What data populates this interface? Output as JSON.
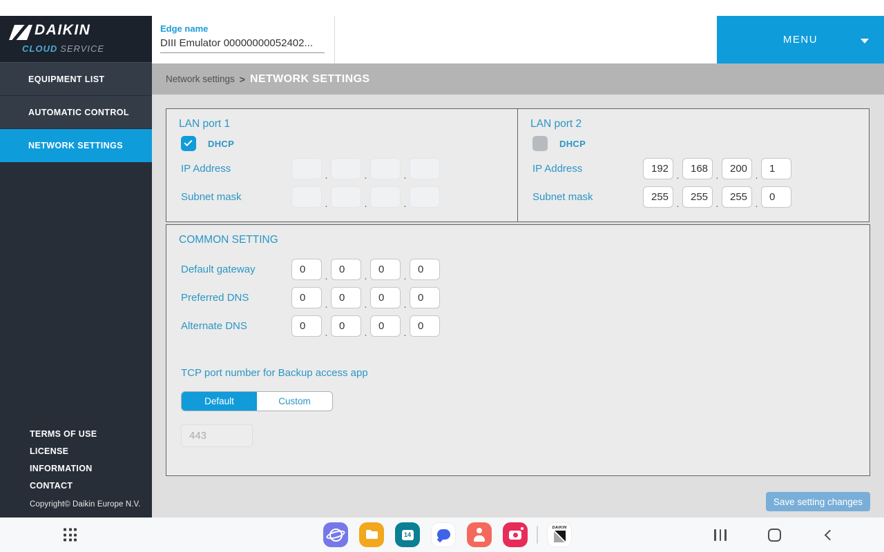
{
  "ui": {
    "dot": "."
  },
  "colors": {
    "accent_blue": "#0f9cdb",
    "label_blue": "#2b96c5",
    "checkbox_blue": "#119bd9",
    "save_button_blue": "#79aed8",
    "breadcrumb_gray": "#b4b4b4",
    "sidebar_dark": "#272e38"
  },
  "sidebar": {
    "logo": {
      "brand": "DAIKIN",
      "cloud": "CLOUD",
      "service": "SERVICE"
    },
    "items": [
      {
        "label": "EQUIPMENT LIST",
        "active": false
      },
      {
        "label": "AUTOMATIC CONTROL",
        "active": false
      },
      {
        "label": "NETWORK SETTINGS",
        "active": true
      }
    ],
    "footer_links": [
      {
        "label": "TERMS OF USE"
      },
      {
        "label": "LICENSE"
      },
      {
        "label": "INFORMATION"
      },
      {
        "label": "CONTACT"
      }
    ],
    "copyright": "Copyright© Daikin Europe N.V."
  },
  "header": {
    "edge_name_label": "Edge name",
    "edge_name_value": "DIII Emulator 00000000052402...",
    "menu_label": "MENU"
  },
  "breadcrumb": {
    "parent": "Network settings",
    "separator": ">",
    "current": "NETWORK SETTINGS"
  },
  "lan_port_1": {
    "title": "LAN port 1",
    "dhcp_label": "DHCP",
    "dhcp_checked": true,
    "ip_label": "IP Address",
    "ip": [
      "",
      "",
      "",
      ""
    ],
    "subnet_label": "Subnet mask",
    "subnet": [
      "",
      "",
      "",
      ""
    ]
  },
  "lan_port_2": {
    "title": "LAN port 2",
    "dhcp_label": "DHCP",
    "dhcp_checked": false,
    "ip_label": "IP Address",
    "ip": [
      "192",
      "168",
      "200",
      "1"
    ],
    "subnet_label": "Subnet mask",
    "subnet": [
      "255",
      "255",
      "255",
      "0"
    ]
  },
  "common_setting": {
    "title": "COMMON SETTING",
    "default_gateway_label": "Default gateway",
    "default_gateway": [
      "0",
      "0",
      "0",
      "0"
    ],
    "preferred_dns_label": "Preferred DNS",
    "preferred_dns": [
      "0",
      "0",
      "0",
      "0"
    ],
    "alternate_dns_label": "Alternate DNS",
    "alternate_dns": [
      "0",
      "0",
      "0",
      "0"
    ],
    "tcp_heading": "TCP port number for Backup access app",
    "toggle": {
      "default_label": "Default",
      "custom_label": "Custom",
      "selected": "Default"
    },
    "tcp_port_value": "443"
  },
  "footer": {
    "save_label": "Save setting changes"
  },
  "taskbar": {
    "calendar_day": "14"
  }
}
